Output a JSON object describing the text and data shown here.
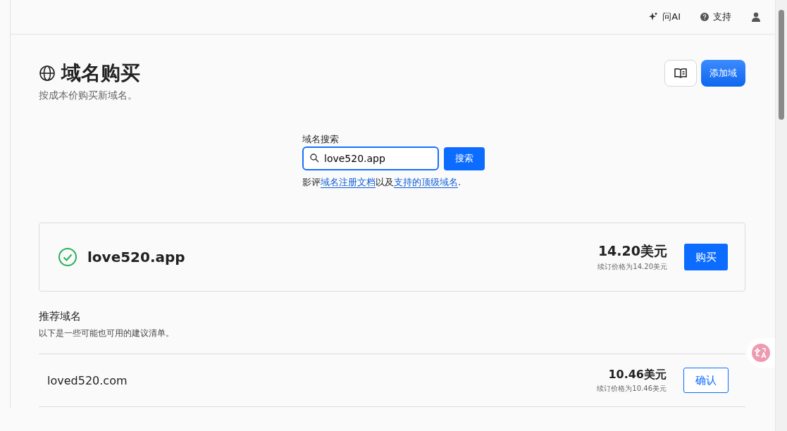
{
  "topbar": {
    "ask_ai": "问AI",
    "support": "支持"
  },
  "header": {
    "title": "域名购买",
    "subtitle": "按成本价购买新域名。",
    "add_button": "添加域"
  },
  "search": {
    "label": "域名搜索",
    "value": "love520.app",
    "button": "搜索",
    "help": [
      {
        "kind": "text",
        "text": "影评"
      },
      {
        "kind": "link",
        "text": "域名注册文档"
      },
      {
        "kind": "text",
        "text": "以及"
      },
      {
        "kind": "link",
        "text": "支持的顶级域名"
      },
      {
        "kind": "text",
        "text": "."
      }
    ]
  },
  "result": {
    "domain": "love520.app",
    "available": true,
    "price": "14.20美元",
    "renewal": "续订价格为14.20美元",
    "button": "购买"
  },
  "suggestions": {
    "title": "推荐域名",
    "subtitle": "以下是一些可能也可用的建议清单。",
    "rows": [
      {
        "domain": "loved520.com",
        "price": "10.46美元",
        "renewal": "续订价格为10.46美元",
        "button": "确认"
      }
    ]
  }
}
